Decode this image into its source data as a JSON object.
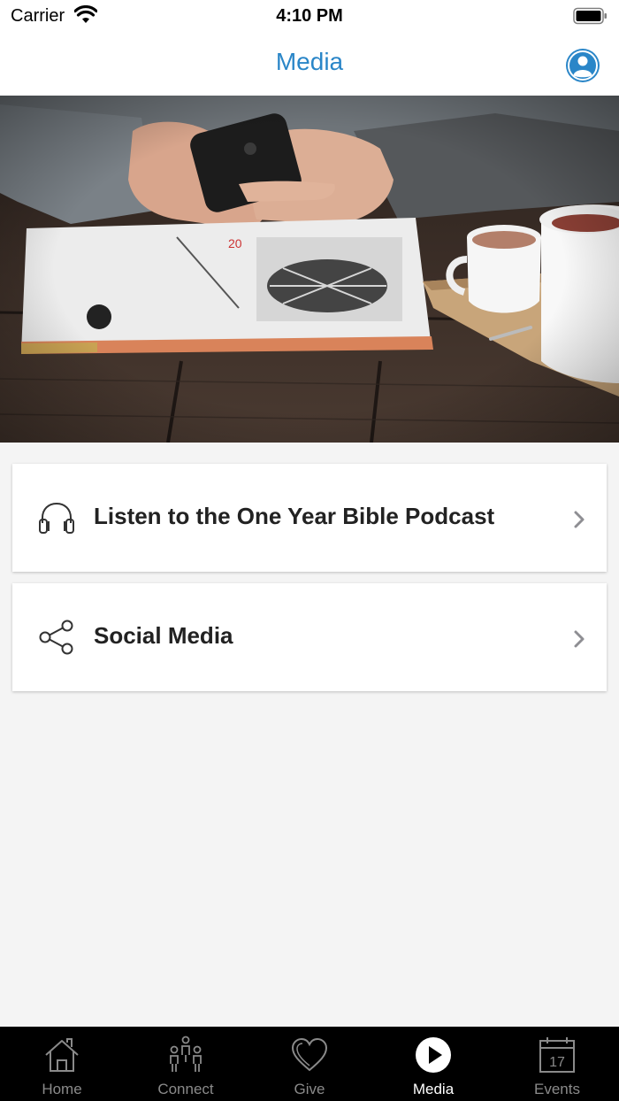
{
  "status_bar": {
    "carrier": "Carrier",
    "time": "4:10 PM"
  },
  "nav": {
    "title": "Media",
    "profile_icon": "person-circle-icon"
  },
  "hero": {
    "icon": "photo-phone-magazine-coffee"
  },
  "cards": [
    {
      "label": "Listen to the One Year Bible Podcast",
      "icon": "headphones-icon"
    },
    {
      "label": "Social Media",
      "icon": "share-icon"
    }
  ],
  "tabs": [
    {
      "label": "Home",
      "icon": "home-icon",
      "active": false
    },
    {
      "label": "Connect",
      "icon": "connect-people-icon",
      "active": false
    },
    {
      "label": "Give",
      "icon": "heart-icon",
      "active": false
    },
    {
      "label": "Media",
      "icon": "play-circle-icon",
      "active": true
    },
    {
      "label": "Events",
      "icon": "calendar-icon",
      "active": false,
      "badge": "17"
    }
  ],
  "colors": {
    "accent": "#2a86c8",
    "tab_bar": "#000000",
    "background": "#f4f4f4"
  }
}
